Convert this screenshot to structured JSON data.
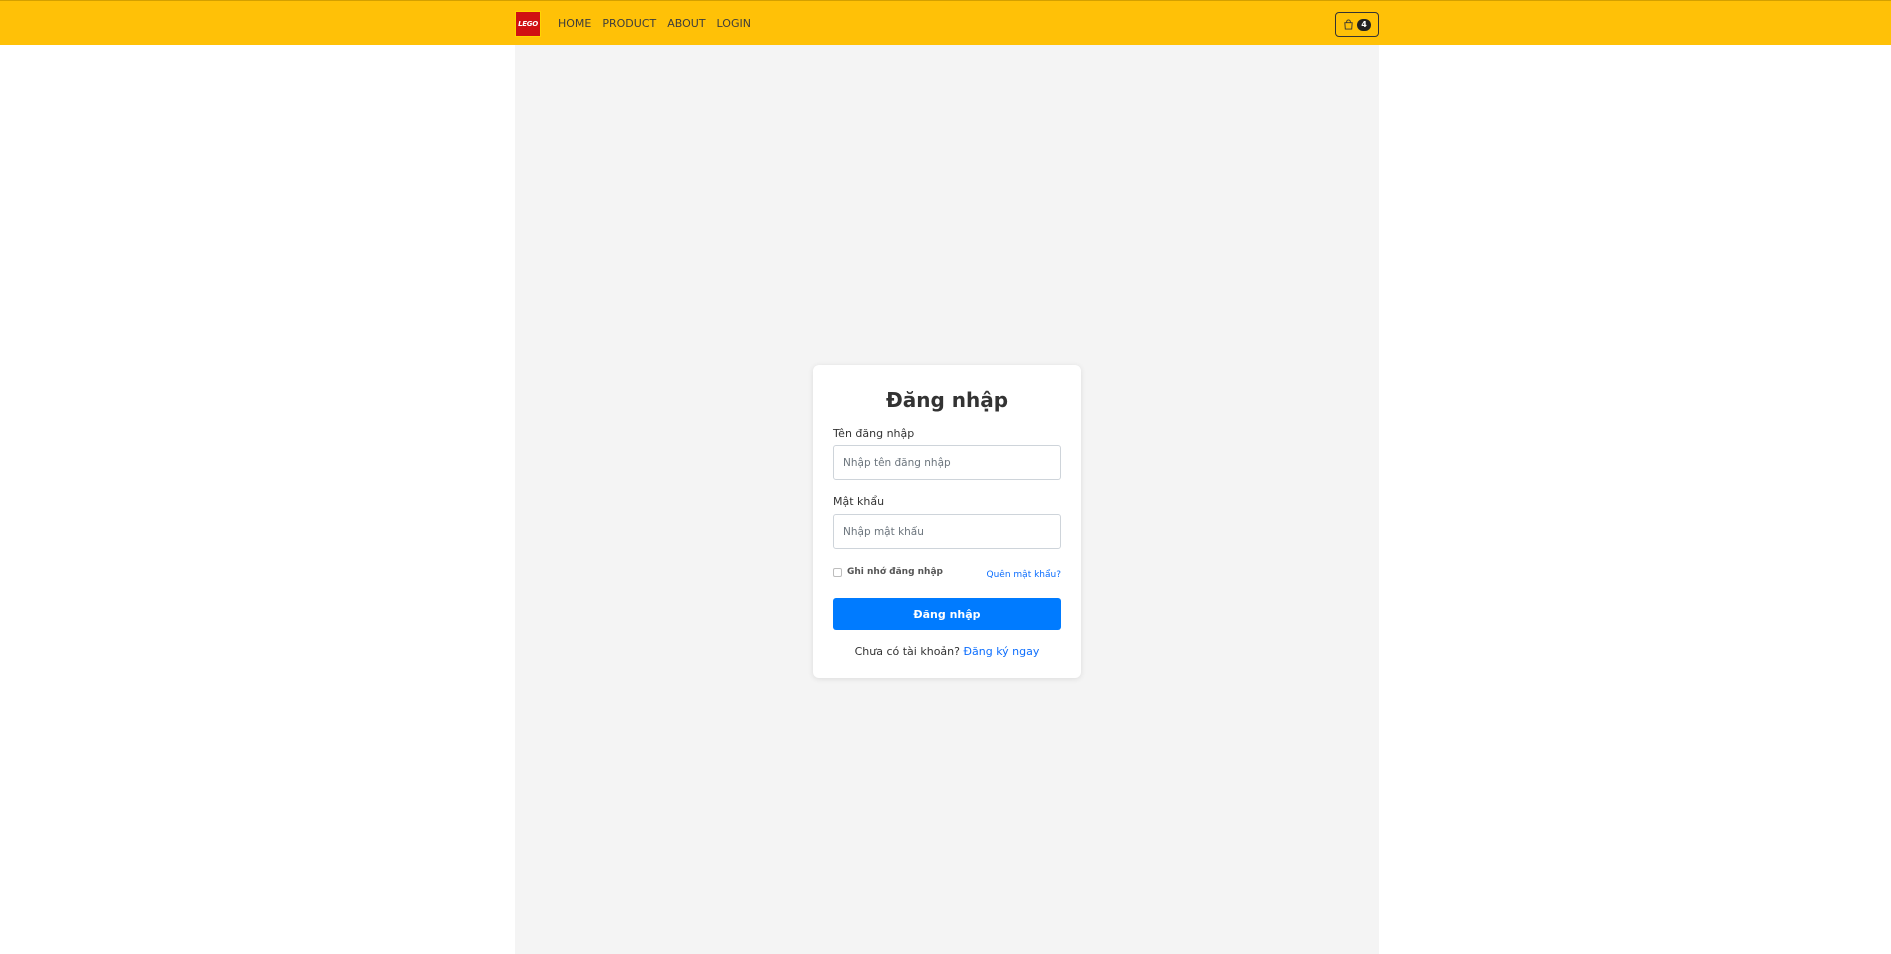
{
  "navbar": {
    "logo_text": "LEGO",
    "links": [
      {
        "label": "HOME"
      },
      {
        "label": "PRODUCT"
      },
      {
        "label": "ABOUT"
      },
      {
        "label": "LOGIN"
      }
    ],
    "cart": {
      "icon": "shopping-bag-icon",
      "count": "4"
    },
    "colors": {
      "background": "#ffc107",
      "logo_bg": "#d01012"
    }
  },
  "login": {
    "title": "Đăng nhập",
    "username_label": "Tên đăng nhập",
    "username_placeholder": "Nhập tên đăng nhập",
    "username_value": "",
    "password_label": "Mật khẩu",
    "password_placeholder": "Nhập mật khẩu",
    "password_value": "",
    "remember_label": "Ghi nhớ đăng nhập",
    "remember_checked": false,
    "forgot_label": "Quên mật khẩu?",
    "submit_label": "Đăng nhập",
    "no_account_text": "Chưa có tài khoản?",
    "signup_link": "Đăng ký ngay",
    "colors": {
      "primary": "#007bff",
      "link": "#0d6efd"
    }
  }
}
